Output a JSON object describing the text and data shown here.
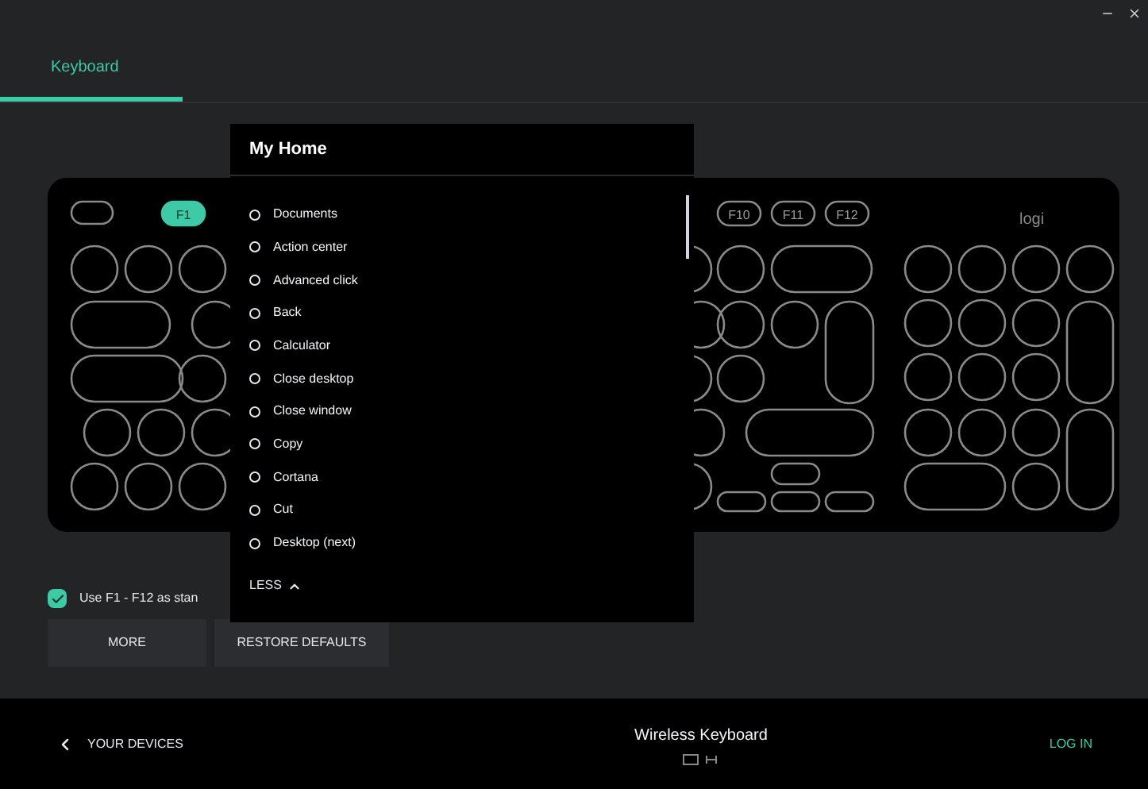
{
  "tabs": [
    {
      "label": "Keyboard",
      "selected": true
    }
  ],
  "keyboard": {
    "function_keys": [
      {
        "label": "F1",
        "selected": true
      },
      {
        "label": "F10",
        "selected": false
      },
      {
        "label": "F11",
        "selected": false
      },
      {
        "label": "F12",
        "selected": false
      }
    ],
    "logo": "logi"
  },
  "dropdown": {
    "title": "My Home",
    "items": [
      {
        "label": "Documents",
        "selected": false
      },
      {
        "label": "Action center",
        "selected": false
      },
      {
        "label": "Advanced click",
        "selected": false
      },
      {
        "label": "Back",
        "selected": false
      },
      {
        "label": "Calculator",
        "selected": false
      },
      {
        "label": "Close desktop",
        "selected": false
      },
      {
        "label": "Close window",
        "selected": false
      },
      {
        "label": "Copy",
        "selected": false
      },
      {
        "label": "Cortana",
        "selected": false
      },
      {
        "label": "Cut",
        "selected": false
      },
      {
        "label": "Desktop (next)",
        "selected": false
      }
    ],
    "toggle": "LESS"
  },
  "checkbox": {
    "label": "Use F1 - F12 as stan",
    "checked": true
  },
  "buttons": [
    "MORE",
    "RESTORE DEFAULTS"
  ],
  "footer": {
    "back": "YOUR DEVICES",
    "device": "Wireless Keyboard",
    "login": "LOG IN"
  }
}
